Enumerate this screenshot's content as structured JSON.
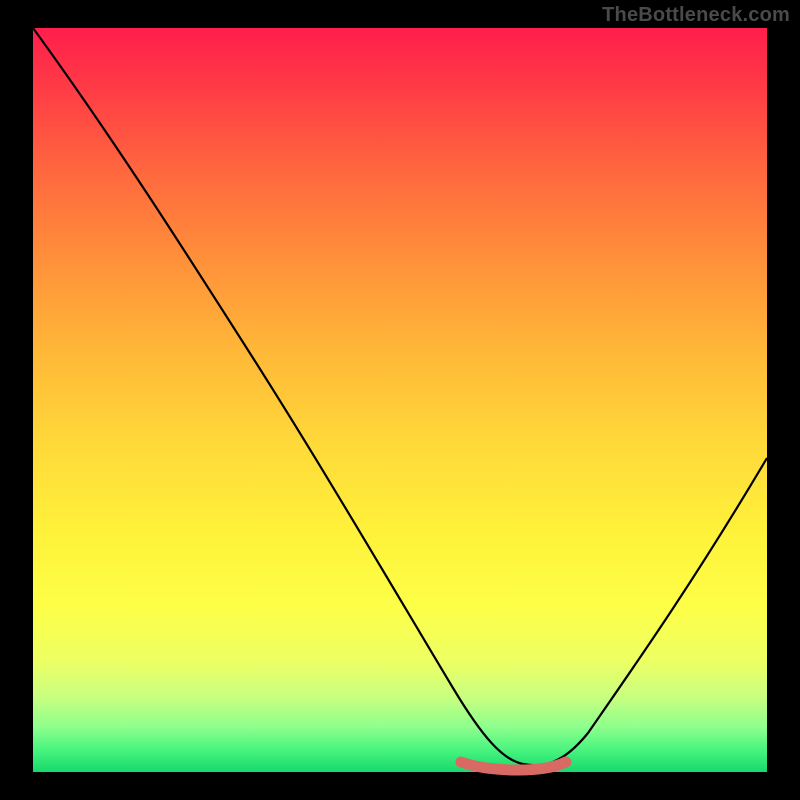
{
  "watermark": "TheBottleneck.com",
  "chart_data": {
    "type": "line",
    "title": "",
    "xlabel": "",
    "ylabel": "",
    "xlim": [
      0,
      100
    ],
    "ylim": [
      0,
      100
    ],
    "series": [
      {
        "name": "bottleneck-curve",
        "x": [
          0,
          5,
          10,
          15,
          20,
          25,
          30,
          35,
          40,
          45,
          50,
          55,
          58,
          60,
          62,
          64,
          66,
          68,
          70,
          72,
          75,
          80,
          85,
          90,
          95,
          100
        ],
        "y": [
          100,
          93,
          85,
          78,
          70,
          62,
          55,
          47,
          40,
          32,
          25,
          17,
          11,
          7,
          4,
          2,
          1,
          1,
          2,
          4,
          8,
          15,
          22,
          30,
          37,
          45
        ],
        "color": "#000000",
        "stroke_width": 2
      },
      {
        "name": "sweet-spot-band",
        "x": [
          58,
          60,
          62,
          64,
          66,
          68,
          70,
          72
        ],
        "y": [
          1.2,
          1.0,
          0.9,
          0.8,
          0.8,
          0.9,
          1.0,
          1.2
        ],
        "color": "#d96a63",
        "stroke_width": 10
      }
    ],
    "gradient_stops": [
      {
        "pos": 0,
        "color": "#ff1e4c"
      },
      {
        "pos": 20,
        "color": "#ff6a3e"
      },
      {
        "pos": 44,
        "color": "#ffb938"
      },
      {
        "pos": 68,
        "color": "#fff23a"
      },
      {
        "pos": 90,
        "color": "#c8ff80"
      },
      {
        "pos": 100,
        "color": "#16d96c"
      }
    ]
  }
}
